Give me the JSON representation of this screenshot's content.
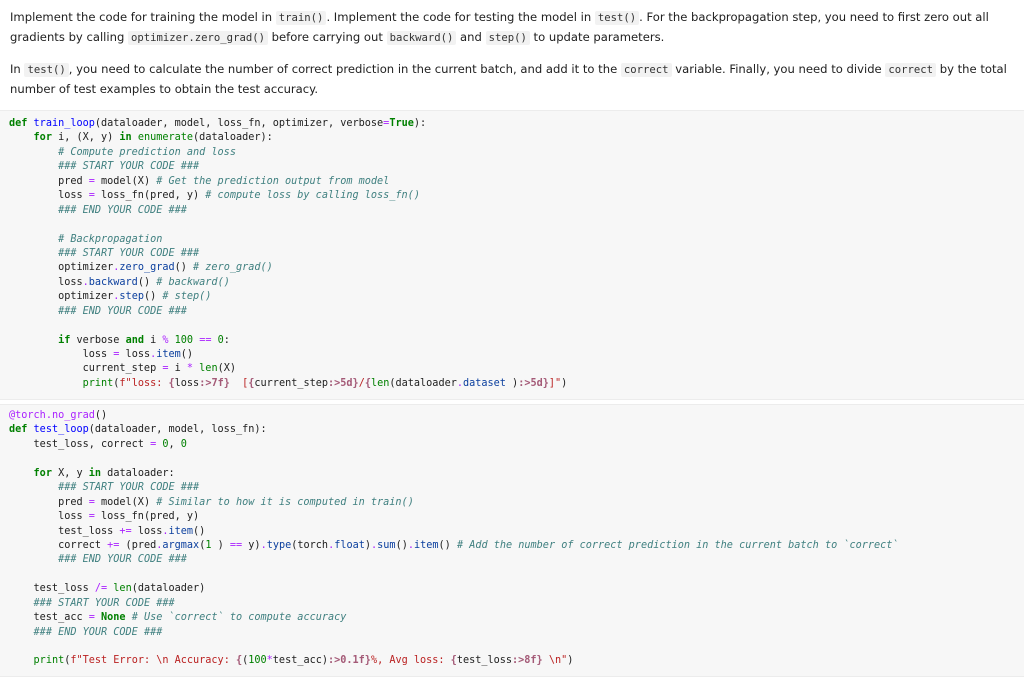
{
  "intro": {
    "p1": [
      {
        "t": "Implement the code for training the model in "
      },
      {
        "c": "train()"
      },
      {
        "t": ". Implement the code for testing the model in "
      },
      {
        "c": "test()"
      },
      {
        "t": ". For the backpropagation step, you need to first zero out all gradients by calling "
      },
      {
        "c": "optimizer.zero_grad()"
      },
      {
        "t": " before carrying out "
      },
      {
        "c": "backward()"
      },
      {
        "t": " and "
      },
      {
        "c": "step()"
      },
      {
        "t": " to update parameters."
      }
    ],
    "p2": [
      {
        "t": "In "
      },
      {
        "c": "test()"
      },
      {
        "t": ", you need to calculate the number of correct prediction in the current batch, and add it to the "
      },
      {
        "c": "correct"
      },
      {
        "t": " variable. Finally, you need to divide "
      },
      {
        "c": "correct"
      },
      {
        "t": " by the total number of test examples to obtain the test accuracy."
      }
    ]
  },
  "cell1": [
    [
      [
        "kw",
        "def "
      ],
      [
        "fn",
        "train_loop"
      ],
      [
        "",
        "(dataloader, model, loss_fn, optimizer, verbose"
      ],
      [
        "op",
        "="
      ],
      [
        "kw",
        "True"
      ],
      [
        "",
        "):"
      ]
    ],
    [
      [
        "",
        "    "
      ],
      [
        "kw",
        "for"
      ],
      [
        "",
        " i, (X, y) "
      ],
      [
        "kw",
        "in"
      ],
      [
        "",
        " "
      ],
      [
        "bi",
        "enumerate"
      ],
      [
        "",
        "(dataloader):"
      ]
    ],
    [
      [
        "",
        "        "
      ],
      [
        "cm",
        "# Compute prediction and loss"
      ]
    ],
    [
      [
        "",
        "        "
      ],
      [
        "cm",
        "### START YOUR CODE ###"
      ]
    ],
    [
      [
        "",
        "        pred "
      ],
      [
        "op",
        "="
      ],
      [
        "",
        " model(X) "
      ],
      [
        "cm",
        "# Get the prediction output from model"
      ]
    ],
    [
      [
        "",
        "        loss "
      ],
      [
        "op",
        "="
      ],
      [
        "",
        " loss_fn(pred, y) "
      ],
      [
        "cm",
        "# compute loss by calling loss_fn()"
      ]
    ],
    [
      [
        "",
        "        "
      ],
      [
        "cm",
        "### END YOUR CODE ###"
      ]
    ],
    [
      [
        "",
        ""
      ]
    ],
    [
      [
        "",
        "        "
      ],
      [
        "cm",
        "# Backpropagation"
      ]
    ],
    [
      [
        "",
        "        "
      ],
      [
        "cm",
        "### START YOUR CODE ###"
      ]
    ],
    [
      [
        "",
        "        optimizer"
      ],
      [
        "op",
        "."
      ],
      [
        "mt",
        "zero_grad"
      ],
      [
        "",
        "() "
      ],
      [
        "cm",
        "# zero_grad()"
      ]
    ],
    [
      [
        "",
        "        loss"
      ],
      [
        "op",
        "."
      ],
      [
        "mt",
        "backward"
      ],
      [
        "",
        "() "
      ],
      [
        "cm",
        "# backward()"
      ]
    ],
    [
      [
        "",
        "        optimizer"
      ],
      [
        "op",
        "."
      ],
      [
        "mt",
        "step"
      ],
      [
        "",
        "() "
      ],
      [
        "cm",
        "# step()"
      ]
    ],
    [
      [
        "",
        "        "
      ],
      [
        "cm",
        "### END YOUR CODE ###"
      ]
    ],
    [
      [
        "",
        ""
      ]
    ],
    [
      [
        "",
        "        "
      ],
      [
        "kw",
        "if"
      ],
      [
        "",
        " verbose "
      ],
      [
        "kw",
        "and"
      ],
      [
        "",
        " i "
      ],
      [
        "op",
        "%"
      ],
      [
        "",
        " "
      ],
      [
        "num",
        "100"
      ],
      [
        "",
        " "
      ],
      [
        "op",
        "=="
      ],
      [
        "",
        " "
      ],
      [
        "num",
        "0"
      ],
      [
        "",
        ":"
      ]
    ],
    [
      [
        "",
        "            loss "
      ],
      [
        "op",
        "="
      ],
      [
        "",
        " loss"
      ],
      [
        "op",
        "."
      ],
      [
        "mt",
        "item"
      ],
      [
        "",
        "()"
      ]
    ],
    [
      [
        "",
        "            current_step "
      ],
      [
        "op",
        "="
      ],
      [
        "",
        " i "
      ],
      [
        "op",
        "*"
      ],
      [
        "",
        " "
      ],
      [
        "bi",
        "len"
      ],
      [
        "",
        "(X)"
      ]
    ],
    [
      [
        "",
        "            "
      ],
      [
        "bi",
        "print"
      ],
      [
        "",
        "("
      ],
      [
        "st",
        "f\"loss: "
      ],
      [
        "sb",
        "{"
      ],
      [
        "",
        "loss"
      ],
      [
        "sb",
        ":>7f}"
      ],
      [
        "st",
        "  ["
      ],
      [
        "sb",
        "{"
      ],
      [
        "",
        "current_step"
      ],
      [
        "sb",
        ":>5d}"
      ],
      [
        "st",
        "/"
      ],
      [
        "sb",
        "{"
      ],
      [
        "bi",
        "len"
      ],
      [
        "",
        "(dataloader"
      ],
      [
        "op",
        "."
      ],
      [
        "mt",
        "dataset"
      ],
      [
        "",
        " )"
      ],
      [
        "sb",
        ":>5d}"
      ],
      [
        "st",
        "]\""
      ],
      [
        "",
        ")"
      ]
    ]
  ],
  "cell2": [
    [
      [
        "at",
        "@torch"
      ],
      [
        "op",
        "."
      ],
      [
        "at",
        "no_grad"
      ],
      [
        "",
        "()"
      ]
    ],
    [
      [
        "kw",
        "def "
      ],
      [
        "fn",
        "test_loop"
      ],
      [
        "",
        "(dataloader, model, loss_fn):"
      ]
    ],
    [
      [
        "",
        "    test_loss, correct "
      ],
      [
        "op",
        "="
      ],
      [
        "",
        " "
      ],
      [
        "num",
        "0"
      ],
      [
        "",
        ", "
      ],
      [
        "num",
        "0"
      ]
    ],
    [
      [
        "",
        ""
      ]
    ],
    [
      [
        "",
        "    "
      ],
      [
        "kw",
        "for"
      ],
      [
        "",
        " X, y "
      ],
      [
        "kw",
        "in"
      ],
      [
        "",
        " dataloader:"
      ]
    ],
    [
      [
        "",
        "        "
      ],
      [
        "cm",
        "### START YOUR CODE ###"
      ]
    ],
    [
      [
        "",
        "        pred "
      ],
      [
        "op",
        "="
      ],
      [
        "",
        " model(X) "
      ],
      [
        "cm",
        "# Similar to how it is computed in train()"
      ]
    ],
    [
      [
        "",
        "        loss "
      ],
      [
        "op",
        "="
      ],
      [
        "",
        " loss_fn(pred, y)"
      ]
    ],
    [
      [
        "",
        "        test_loss "
      ],
      [
        "op",
        "+="
      ],
      [
        "",
        " loss"
      ],
      [
        "op",
        "."
      ],
      [
        "mt",
        "item"
      ],
      [
        "",
        "()"
      ]
    ],
    [
      [
        "",
        "        correct "
      ],
      [
        "op",
        "+="
      ],
      [
        "",
        " (pred"
      ],
      [
        "op",
        "."
      ],
      [
        "mt",
        "argmax"
      ],
      [
        "",
        "("
      ],
      [
        "num",
        "1"
      ],
      [
        "",
        " ) "
      ],
      [
        "op",
        "=="
      ],
      [
        "",
        " y)"
      ],
      [
        "op",
        "."
      ],
      [
        "mt",
        "type"
      ],
      [
        "",
        "(torch"
      ],
      [
        "op",
        "."
      ],
      [
        "mt",
        "float"
      ],
      [
        "",
        ")"
      ],
      [
        "op",
        "."
      ],
      [
        "mt",
        "sum"
      ],
      [
        "",
        "()"
      ],
      [
        "op",
        "."
      ],
      [
        "mt",
        "item"
      ],
      [
        "",
        "() "
      ],
      [
        "cm",
        "# Add the number of correct prediction in the current batch to `correct`"
      ]
    ],
    [
      [
        "",
        "        "
      ],
      [
        "cm",
        "### END YOUR CODE ###"
      ]
    ],
    [
      [
        "",
        ""
      ]
    ],
    [
      [
        "",
        "    test_loss "
      ],
      [
        "op",
        "/="
      ],
      [
        "",
        " "
      ],
      [
        "bi",
        "len"
      ],
      [
        "",
        "(dataloader)"
      ]
    ],
    [
      [
        "",
        "    "
      ],
      [
        "cm",
        "### START YOUR CODE ###"
      ]
    ],
    [
      [
        "",
        "    test_acc "
      ],
      [
        "op",
        "="
      ],
      [
        "",
        " "
      ],
      [
        "kw",
        "None"
      ],
      [
        "",
        " "
      ],
      [
        "cm",
        "# Use `correct` to compute accuracy"
      ]
    ],
    [
      [
        "",
        "    "
      ],
      [
        "cm",
        "### END YOUR CODE ###"
      ]
    ],
    [
      [
        "",
        ""
      ]
    ],
    [
      [
        "",
        "    "
      ],
      [
        "bi",
        "print"
      ],
      [
        "",
        "("
      ],
      [
        "st",
        "f\"Test Error: \\n Accuracy: "
      ],
      [
        "sb",
        "{"
      ],
      [
        "",
        "("
      ],
      [
        "num",
        "100"
      ],
      [
        "op",
        "*"
      ],
      [
        "",
        "test_acc)"
      ],
      [
        "sb",
        ":>0.1f}"
      ],
      [
        "st",
        "%, Avg loss: "
      ],
      [
        "sb",
        "{"
      ],
      [
        "",
        "test_loss"
      ],
      [
        "sb",
        ":>8f}"
      ],
      [
        "st",
        " \\n\""
      ],
      [
        "",
        ")"
      ]
    ]
  ]
}
